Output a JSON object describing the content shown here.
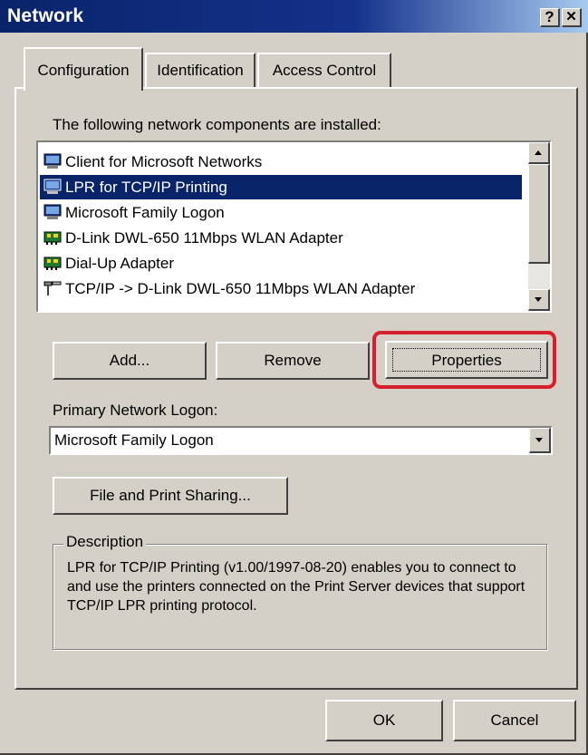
{
  "window": {
    "title": "Network",
    "help_glyph": "?",
    "close_glyph": "✕"
  },
  "tabs": [
    {
      "label": "Configuration",
      "active": true
    },
    {
      "label": "Identification",
      "active": false
    },
    {
      "label": "Access Control",
      "active": false
    }
  ],
  "components": {
    "label": "The following network components are installed:",
    "items": [
      {
        "label": "Client for Microsoft Networks",
        "icon": "network-client-icon",
        "selected": false
      },
      {
        "label": "LPR for TCP/IP Printing",
        "icon": "network-client-icon",
        "selected": true
      },
      {
        "label": "Microsoft Family Logon",
        "icon": "network-client-icon",
        "selected": false
      },
      {
        "label": "D-Link DWL-650 11Mbps WLAN Adapter",
        "icon": "network-adapter-icon",
        "selected": false
      },
      {
        "label": "Dial-Up Adapter",
        "icon": "network-adapter-icon",
        "selected": false
      },
      {
        "label": "TCP/IP -> D-Link DWL-650 11Mbps WLAN Adapter",
        "icon": "protocol-icon",
        "selected": false
      }
    ]
  },
  "buttons": {
    "add": "Add...",
    "remove": "Remove",
    "properties": "Properties",
    "file_print_sharing": "File and Print Sharing...",
    "ok": "OK",
    "cancel": "Cancel"
  },
  "logon": {
    "label": "Primary Network Logon:",
    "value": "Microsoft Family Logon"
  },
  "description": {
    "title": "Description",
    "text": "LPR for TCP/IP Printing (v1.00/1997-08-20) enables you to connect to and use the printers connected on the Print Server devices that support TCP/IP LPR printing protocol."
  },
  "colors": {
    "highlight": "#d7202e",
    "selection": "#0a246a",
    "face": "#d4d0c8"
  }
}
